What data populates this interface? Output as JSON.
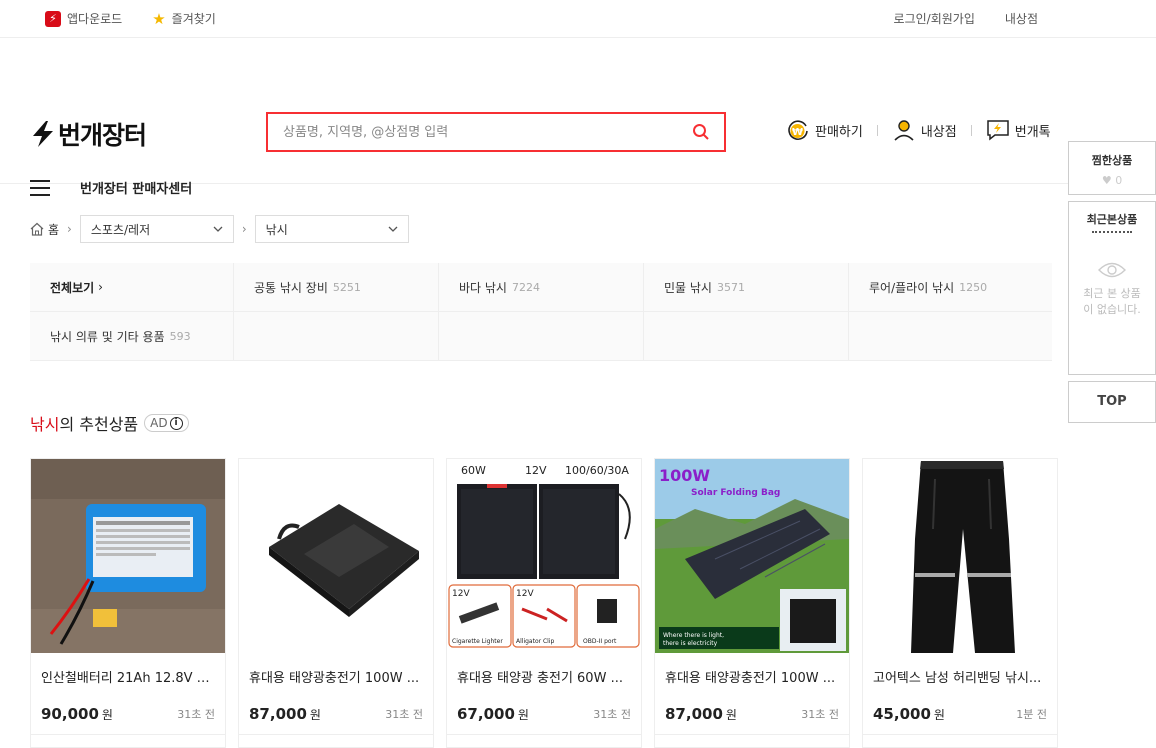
{
  "topbar": {
    "app_download": "앱다운로드",
    "bookmark": "즐겨찾기",
    "login": "로그인/회원가입",
    "my_shop": "내상점"
  },
  "header": {
    "logo_text": "번개장터",
    "search_placeholder": "상품명, 지역명, @상점명 입력",
    "actions": [
      "판매하기",
      "내상점",
      "번개톡"
    ],
    "seller_center": "번개장터 판매자센터"
  },
  "breadcrumb": {
    "home": "홈",
    "category1": "스포츠/레저",
    "category2": "낚시"
  },
  "categories": [
    {
      "label": "전체보기",
      "count": "",
      "is_all": true
    },
    {
      "label": "공통 낚시 장비",
      "count": "5251"
    },
    {
      "label": "바다 낚시",
      "count": "7224"
    },
    {
      "label": "민물 낚시",
      "count": "3571"
    },
    {
      "label": "루어/플라이 낚시",
      "count": "1250"
    },
    {
      "label": "낚시 의류 및 기타 용품",
      "count": "593"
    },
    {
      "label": "",
      "count": ""
    },
    {
      "label": "",
      "count": ""
    },
    {
      "label": "",
      "count": ""
    },
    {
      "label": "",
      "count": ""
    }
  ],
  "recommend": {
    "category": "낚시",
    "suffix": "의 추천상품",
    "ad_label": "AD"
  },
  "products": [
    {
      "name": "인산철배터리 21Ah 12.8V B...",
      "price": "90,000",
      "unit": "원",
      "time": "31초 전"
    },
    {
      "name": "휴대용 태양광충전기 100W ...",
      "price": "87,000",
      "unit": "원",
      "time": "31초 전"
    },
    {
      "name": "휴대용 태양광 충전기 60W ...",
      "price": "67,000",
      "unit": "원",
      "time": "31초 전"
    },
    {
      "name": "휴대용 태양광충전기 100W ...",
      "price": "87,000",
      "unit": "원",
      "time": "31초 전"
    },
    {
      "name": "고어텍스 남성 허리밴딩 낚시...",
      "price": "45,000",
      "unit": "원",
      "time": "1분 전"
    }
  ],
  "product_image_text": {
    "p3_watt": "60W",
    "p3_volt": "12V",
    "p3_amp": "100/60/30A",
    "p3_a1": "12V",
    "p3_a2": "12V",
    "p3_c1": "Cigarette Lighter",
    "p3_c2": "Alligator Clip",
    "p3_c3": "OBD-II port",
    "p4_watt": "100W",
    "p4_sub": "Solar Folding Bag",
    "p4_note1": "Where there is light,",
    "p4_note2": "there is electricity"
  },
  "sidebar": {
    "wishlist_title": "찜한상품",
    "wishlist_count": "0",
    "recent_title": "최근본상품",
    "recent_empty": "최근 본 상품이 없습니다.",
    "top": "TOP"
  },
  "colors": {
    "brand_red": "#d80c18",
    "search_border": "#f72f33"
  }
}
